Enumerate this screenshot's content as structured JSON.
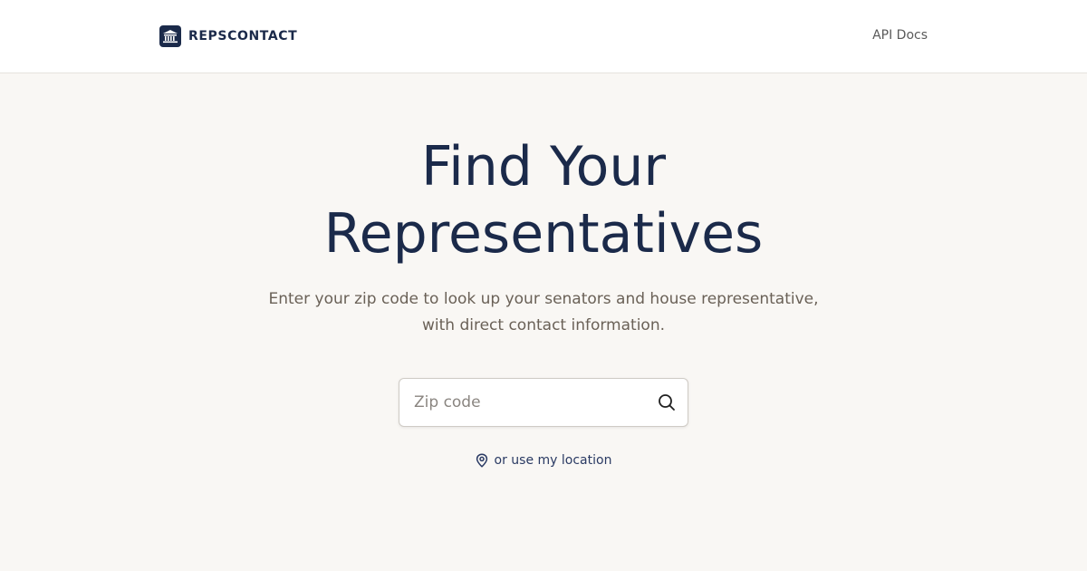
{
  "header": {
    "brand_name": "REPSCONTACT",
    "logo_icon": "capitol-building-icon",
    "nav": {
      "api_docs_label": "API Docs"
    }
  },
  "hero": {
    "title_line1": "Find Your",
    "title_line2": "Representatives",
    "subtitle_line1": "Enter your zip code to look up your senators and house representative,",
    "subtitle_line2": "with direct contact information."
  },
  "search": {
    "placeholder": "Zip code",
    "value": "",
    "button_icon": "search-icon"
  },
  "location": {
    "label": "or use my location",
    "icon": "map-pin-icon"
  },
  "colors": {
    "navy": "#1b2a4a",
    "background": "#f9f7f4",
    "header_bg": "#ffffff",
    "subtitle_text": "#6a6157",
    "link_text": "#2a3a63"
  }
}
